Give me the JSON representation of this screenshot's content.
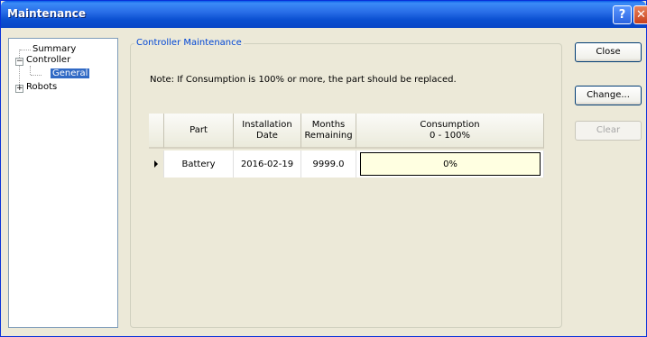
{
  "window": {
    "title": "Maintenance",
    "help_label": "?",
    "close_label": "✕"
  },
  "tree": {
    "items": [
      {
        "label": "Summary",
        "expander": ""
      },
      {
        "label": "Controller",
        "expander": "−"
      },
      {
        "label": "General",
        "expander": "",
        "selected": true
      },
      {
        "label": "Robots",
        "expander": "+"
      }
    ]
  },
  "group": {
    "label": "Controller Maintenance",
    "note": "Note: If Consumption is 100% or more, the part should be replaced."
  },
  "table": {
    "headers": {
      "part": "Part",
      "installation_line1": "Installation",
      "installation_line2": "Date",
      "months_line1": "Months",
      "months_line2": "Remaining",
      "consumption_line1": "Consumption",
      "consumption_line2": "0 - 100%"
    },
    "rows": [
      {
        "part": "Battery",
        "installation_date": "2016-02-19",
        "months_remaining": "9999.0",
        "consumption": "0%"
      }
    ]
  },
  "buttons": {
    "close": "Close",
    "change": "Change...",
    "clear": "Clear"
  }
}
